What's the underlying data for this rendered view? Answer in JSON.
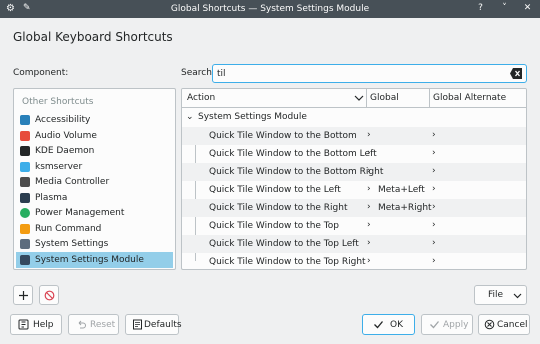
{
  "window": {
    "title": "Global Shortcuts — System Settings Module",
    "app_icon": "settings-icon",
    "pin_icon": "pin-icon"
  },
  "page": {
    "heading": "Global Keyboard Shortcuts",
    "component_label": "Component:",
    "search_label": "Search:",
    "search_value": "til",
    "search_placeholder": ""
  },
  "components": {
    "header": "Other Shortcuts",
    "items": [
      {
        "label": "Accessibility",
        "icon": "accessibility-icon",
        "color": "#2980b9"
      },
      {
        "label": "Audio Volume",
        "icon": "speaker-icon",
        "color": "#e74c3c"
      },
      {
        "label": "KDE Daemon",
        "icon": "kde-daemon-icon",
        "color": "#232627"
      },
      {
        "label": "ksmserver",
        "icon": "session-icon",
        "color": "#3daee9"
      },
      {
        "label": "Media Controller",
        "icon": "media-icon",
        "color": "#4d4d4d"
      },
      {
        "label": "Plasma",
        "icon": "plasma-icon",
        "color": "#2c3e50"
      },
      {
        "label": "Power Management",
        "icon": "power-icon",
        "color": "#27ae60"
      },
      {
        "label": "Run Command",
        "icon": "run-command-icon",
        "color": "#f39c12"
      },
      {
        "label": "System Settings",
        "icon": "system-settings-icon",
        "color": "#5d6d7e"
      },
      {
        "label": "System Settings Module",
        "icon": "settings-module-icon",
        "color": "#34495e"
      }
    ],
    "selected_index": 9
  },
  "table": {
    "columns": [
      "Action",
      "Global",
      "Global Alternate"
    ],
    "group": "System Settings Module",
    "rows": [
      {
        "action": "Quick Tile Window to the Bottom",
        "global": "",
        "alternate": ""
      },
      {
        "action": "Quick Tile Window to the Bottom Left",
        "global": "",
        "alternate": ""
      },
      {
        "action": "Quick Tile Window to the Bottom Right",
        "global": "",
        "alternate": ""
      },
      {
        "action": "Quick Tile Window to the Left",
        "global": "Meta+Left",
        "alternate": ""
      },
      {
        "action": "Quick Tile Window to the Right",
        "global": "Meta+Right",
        "alternate": ""
      },
      {
        "action": "Quick Tile Window to the Top",
        "global": "",
        "alternate": ""
      },
      {
        "action": "Quick Tile Window to the Top Left",
        "global": "",
        "alternate": ""
      },
      {
        "action": "Quick Tile Window to the Top Right",
        "global": "",
        "alternate": ""
      }
    ],
    "chevron": "›"
  },
  "buttons": {
    "add_icon": "add-icon",
    "remove_icon": "remove-icon",
    "file": "File",
    "help": "Help",
    "reset": "Reset",
    "defaults": "Defaults",
    "ok": "OK",
    "apply": "Apply",
    "cancel": "Cancel"
  },
  "colors": {
    "accent": "#3daee9",
    "titlebar": "#475057"
  }
}
